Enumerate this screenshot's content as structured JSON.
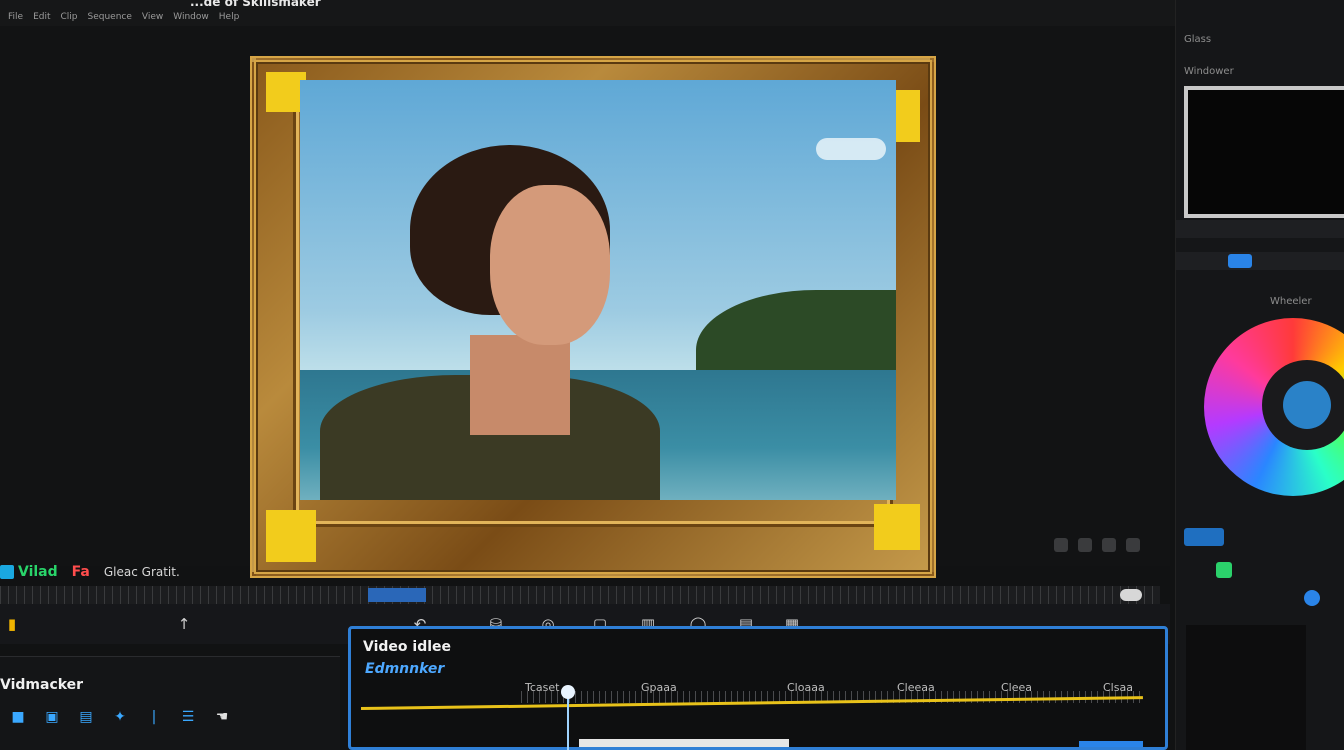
{
  "app": {
    "title": "...de of Skillsmaker",
    "menu": [
      "File",
      "Edit",
      "Clip",
      "Sequence",
      "View",
      "Window",
      "Help"
    ]
  },
  "viewer": {
    "labels": {
      "video": "Vilad",
      "track_icon": "Fa",
      "clip_name": "Gleac Gratit."
    }
  },
  "toolbar": {
    "icons": [
      "upload-arrow-icon",
      "undo-icon",
      "bucket-icon",
      "location-icon",
      "copy-icon",
      "split-icon",
      "record-icon",
      "keyframe-icon",
      "grid-icon"
    ]
  },
  "left_panel": {
    "title": "Vidmacker",
    "tools": [
      "square",
      "image",
      "film",
      "sparkle",
      "bar",
      "text",
      "pointer"
    ]
  },
  "timeline": {
    "title": "Video idlee",
    "subtitle": "Edmnnker",
    "marks": [
      "Tcaset",
      "Gpaaa",
      "Cloaaa",
      "Cleeaa",
      "Cleea",
      "Clsaa"
    ]
  },
  "right_panel": {
    "top_label": "Glass",
    "section_label": "Windower",
    "wheel_label": "Wheeler"
  },
  "colors": {
    "accent": "#2f7fd6",
    "timeline_line": "#e8c21a",
    "frame_gold": "#c59a4a",
    "corner_yellow": "#f2cc1c"
  }
}
